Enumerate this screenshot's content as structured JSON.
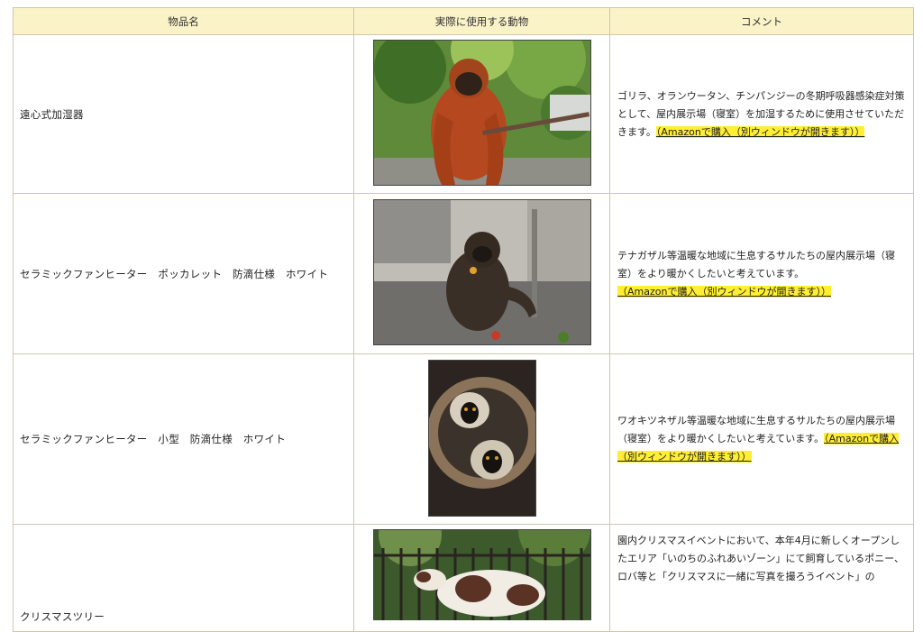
{
  "table": {
    "headers": [
      "物品名",
      "実際に使用する動物",
      "コメント"
    ],
    "rows": [
      {
        "item": "遠心式加湿器",
        "photo_subject": "orangutan",
        "comment": "ゴリラ、オランウータン、チンパンジーの冬期呼吸器感染症対策として、屋内展示場（寝室）を加湿するために使用させていただきます。",
        "link": "（Amazonで購入（別ウィンドウが開きます））"
      },
      {
        "item": "セラミックファンヒーター　ポッカレット　防滴仕様　ホワイト",
        "photo_subject": "gibbon",
        "comment": "テナガザル等温暖な地域に生息するサルたちの屋内展示場（寝室）をより暖かくしたいと考えています。",
        "link": "（Amazonで購入（別ウィンドウが開きます））"
      },
      {
        "item": "セラミックファンヒーター　小型　防滴仕様　ホワイト",
        "photo_subject": "ruffed-lemur",
        "comment": "ワオキツネザル等温暖な地域に生息するサルたちの屋内展示場（寝室）をより暖かくしたいと考えています。",
        "link": "（Amazonで購入（別ウィンドウが開きます））"
      },
      {
        "item": "クリスマスツリー",
        "photo_subject": "pony",
        "comment": "園内クリスマスイベントにおいて、本年4月に新しくオープンしたエリア「いのちのふれあいゾーン」にて飼育しているポニー、ロバ等と「クリスマスに一緒に写真を撮ろうイベント」の",
        "link": ""
      }
    ]
  },
  "colors": {
    "header_bg": "#fbf3c8",
    "border": "#cfc7a9",
    "highlight": "#ffee33"
  }
}
